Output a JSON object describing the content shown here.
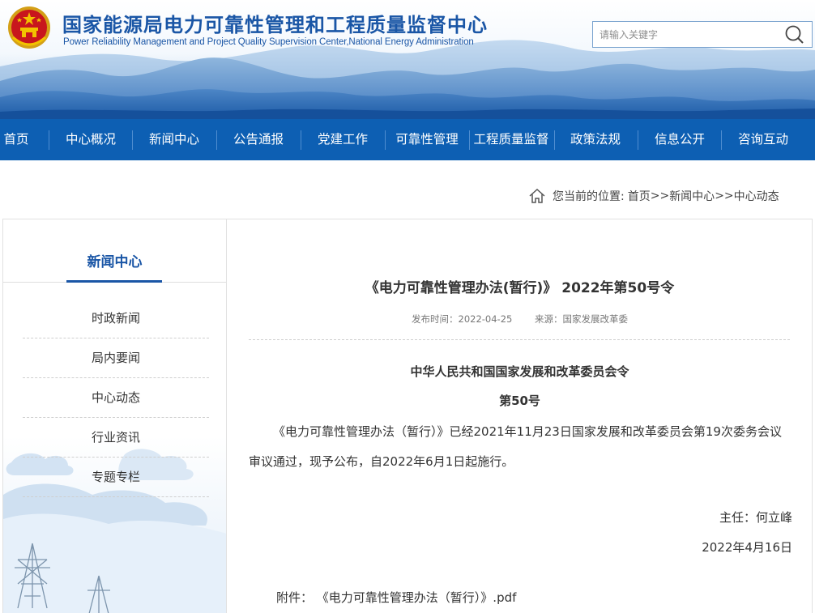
{
  "header": {
    "title": "国家能源局电力可靠性管理和工程质量监督中心",
    "subtitle": "Power Reliability Management and Project Quality Supervision Center,National Energy Administration",
    "search_placeholder": "请输入关键字"
  },
  "nav": {
    "items": [
      {
        "label": "首页"
      },
      {
        "label": "中心概况"
      },
      {
        "label": "新闻中心"
      },
      {
        "label": "公告通报"
      },
      {
        "label": "党建工作"
      },
      {
        "label": "可靠性管理"
      },
      {
        "label": "工程质量监督"
      },
      {
        "label": "政策法规"
      },
      {
        "label": "信息公开"
      },
      {
        "label": "咨询互动"
      }
    ]
  },
  "breadcrumb": {
    "prefix": "您当前的位置:",
    "home": "首页",
    "sep1": ">>",
    "section": "新闻中心",
    "sep2": ">>",
    "current": "中心动态"
  },
  "sidebar": {
    "title": "新闻中心",
    "items": [
      {
        "label": "时政新闻"
      },
      {
        "label": "局内要闻"
      },
      {
        "label": "中心动态"
      },
      {
        "label": "行业资讯"
      },
      {
        "label": "专题专栏"
      }
    ]
  },
  "article": {
    "title": "《电力可靠性管理办法(暂行)》 2022年第50号令",
    "publish_time": "发布时间：2022-04-25",
    "source": "来源：国家发展改革委",
    "issuer": "中华人民共和国国家发展和改革委员会令",
    "order_no": "第50号",
    "body": "《电力可靠性管理办法（暂行）》已经2021年11月23日国家发展和改革委员会第19次委务会议审议通过，现予公布，自2022年6月1日起施行。",
    "signature": "主任：何立峰",
    "date": "2022年4月16日",
    "attachment_label": "附件：",
    "attachment_link": "《电力可靠性管理办法（暂行）》.pdf"
  },
  "colors": {
    "nav_bg": "#0d5fb3",
    "brand_blue": "#1a56a6"
  }
}
